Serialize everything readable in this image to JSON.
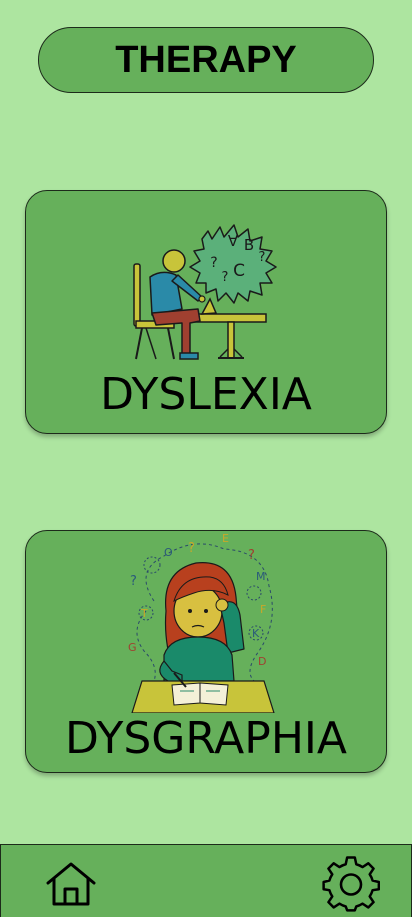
{
  "header": {
    "title": "THERAPY"
  },
  "cards": [
    {
      "label": "DYSLEXIA",
      "icon": "dyslexia-illustration"
    },
    {
      "label": "DYSGRAPHIA",
      "icon": "dysgraphia-illustration"
    }
  ],
  "bottom_nav": {
    "home_icon": "home-icon",
    "settings_icon": "gear-icon"
  },
  "colors": {
    "background": "#ade5a0",
    "surface": "#66b05b",
    "outline": "#1c2a1a"
  },
  "dyslexia_art": {
    "letters": [
      "A",
      "B",
      "C",
      "?",
      "?",
      "?"
    ]
  },
  "dysgraphia_art": {
    "letters": [
      "O",
      "?",
      "E",
      "?",
      "?",
      "M",
      "T",
      "F",
      "G",
      "K",
      "D"
    ]
  }
}
